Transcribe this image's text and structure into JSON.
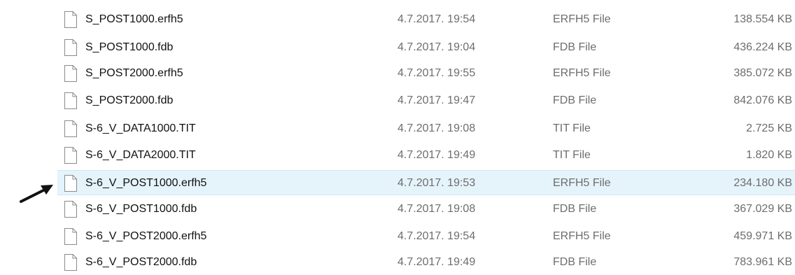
{
  "files": [
    {
      "name": "S_POST1000.erfh5",
      "date": "4.7.2017. 19:54",
      "type": "ERFH5 File",
      "size": "138.554 KB",
      "icon": "file-icon"
    },
    {
      "name": "S_POST1000.fdb",
      "date": "4.7.2017. 19:04",
      "type": "FDB File",
      "size": "436.224 KB",
      "icon": "file-icon"
    },
    {
      "name": "S_POST2000.erfh5",
      "date": "4.7.2017. 19:55",
      "type": "ERFH5 File",
      "size": "385.072 KB",
      "icon": "file-icon"
    },
    {
      "name": "S_POST2000.fdb",
      "date": "4.7.2017. 19:47",
      "type": "FDB File",
      "size": "842.076 KB",
      "icon": "file-icon"
    },
    {
      "name": "S-6_V_DATA1000.TIT",
      "date": "4.7.2017. 19:08",
      "type": "TIT File",
      "size": "2.725 KB",
      "icon": "file-icon"
    },
    {
      "name": "S-6_V_DATA2000.TIT",
      "date": "4.7.2017. 19:49",
      "type": "TIT File",
      "size": "1.820 KB",
      "icon": "file-icon"
    },
    {
      "name": "S-6_V_POST1000.erfh5",
      "date": "4.7.2017. 19:53",
      "type": "ERFH5 File",
      "size": "234.180 KB",
      "icon": "file-icon",
      "selected": true
    },
    {
      "name": "S-6_V_POST1000.fdb",
      "date": "4.7.2017. 19:08",
      "type": "FDB File",
      "size": "367.029 KB",
      "icon": "file-icon"
    },
    {
      "name": "S-6_V_POST2000.erfh5",
      "date": "4.7.2017. 19:54",
      "type": "ERFH5 File",
      "size": "459.971 KB",
      "icon": "file-icon"
    },
    {
      "name": "S-6_V_POST2000.fdb",
      "date": "4.7.2017. 19:49",
      "type": "FDB File",
      "size": "783.961 KB",
      "icon": "file-icon"
    }
  ],
  "highlight": {
    "color": "#e5f3fb",
    "border": "#cde8f7"
  },
  "annotation": {
    "icon": "black-arrow-icon",
    "color": "#111111"
  }
}
